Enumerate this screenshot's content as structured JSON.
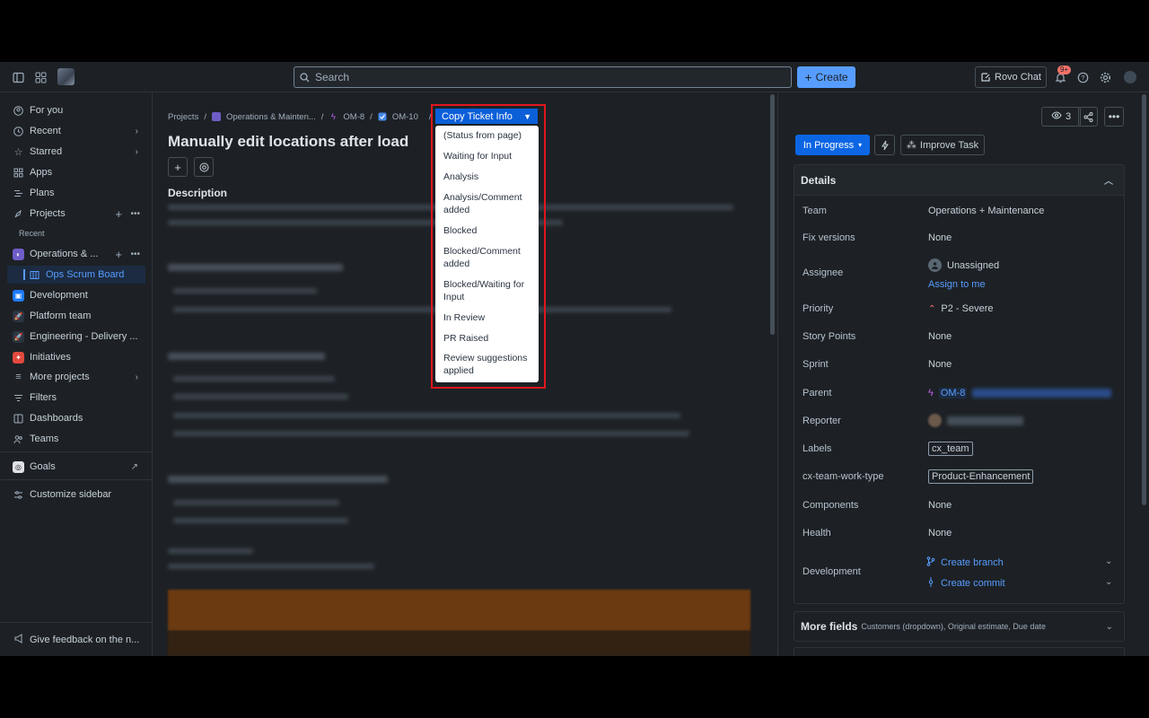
{
  "topbar": {
    "search_placeholder": "Search",
    "create_label": "Create",
    "rovo_label": "Rovo Chat",
    "notif_badge": "9+"
  },
  "sidebar": {
    "for_you": "For you",
    "recent": "Recent",
    "starred": "Starred",
    "apps": "Apps",
    "plans": "Plans",
    "projects": "Projects",
    "recent_sub": "Recent",
    "project_ops": "Operations & ...",
    "board": "Ops Scrum Board",
    "development": "Development",
    "platform": "Platform team",
    "engineering": "Engineering - Delivery ...",
    "initiatives": "Initiatives",
    "more_projects": "More projects",
    "filters": "Filters",
    "dashboards": "Dashboards",
    "teams": "Teams",
    "goals": "Goals",
    "customize": "Customize sidebar",
    "feedback": "Give feedback on the n..."
  },
  "breadcrumb": {
    "projects": "Projects",
    "ops": "Operations & Mainten...",
    "parent": "OM-8",
    "issue": "OM-10"
  },
  "issue": {
    "title": "Manually edit locations after load",
    "description_heading": "Description"
  },
  "copy_ticket": {
    "label": "Copy Ticket Info",
    "options": [
      "(Status from page)",
      "Waiting for Input",
      "Analysis",
      "Analysis/Comment added",
      "Blocked",
      "Blocked/Comment added",
      "Blocked/Waiting for Input",
      "In Review",
      "PR Raised",
      "Review suggestions applied"
    ]
  },
  "right": {
    "watchers": "3",
    "status": "In Progress",
    "improve": "Improve Task",
    "details_title": "Details",
    "fields": {
      "team_label": "Team",
      "team_value": "Operations + Maintenance",
      "fix_label": "Fix versions",
      "fix_value": "None",
      "assignee_label": "Assignee",
      "assignee_value": "Unassigned",
      "assign_me": "Assign to me",
      "priority_label": "Priority",
      "priority_value": "P2 - Severe",
      "points_label": "Story Points",
      "points_value": "None",
      "sprint_label": "Sprint",
      "sprint_value": "None",
      "parent_label": "Parent",
      "parent_value": "OM-8",
      "reporter_label": "Reporter",
      "labels_label": "Labels",
      "labels_value": "cx_team",
      "worktype_label": "cx-team-work-type",
      "worktype_value": "Product-Enhancement",
      "components_label": "Components",
      "components_value": "None",
      "health_label": "Health",
      "health_value": "None",
      "development_label": "Development",
      "create_branch": "Create branch",
      "create_commit": "Create commit"
    },
    "more_fields_title": "More fields",
    "more_fields_sub": "Customers (dropdown), Original estimate, Due date"
  },
  "colors": {
    "accent": "#579dff",
    "status_blue": "#0c66e4",
    "priority_red": "#f87168",
    "highlight_red": "#e0161e"
  }
}
